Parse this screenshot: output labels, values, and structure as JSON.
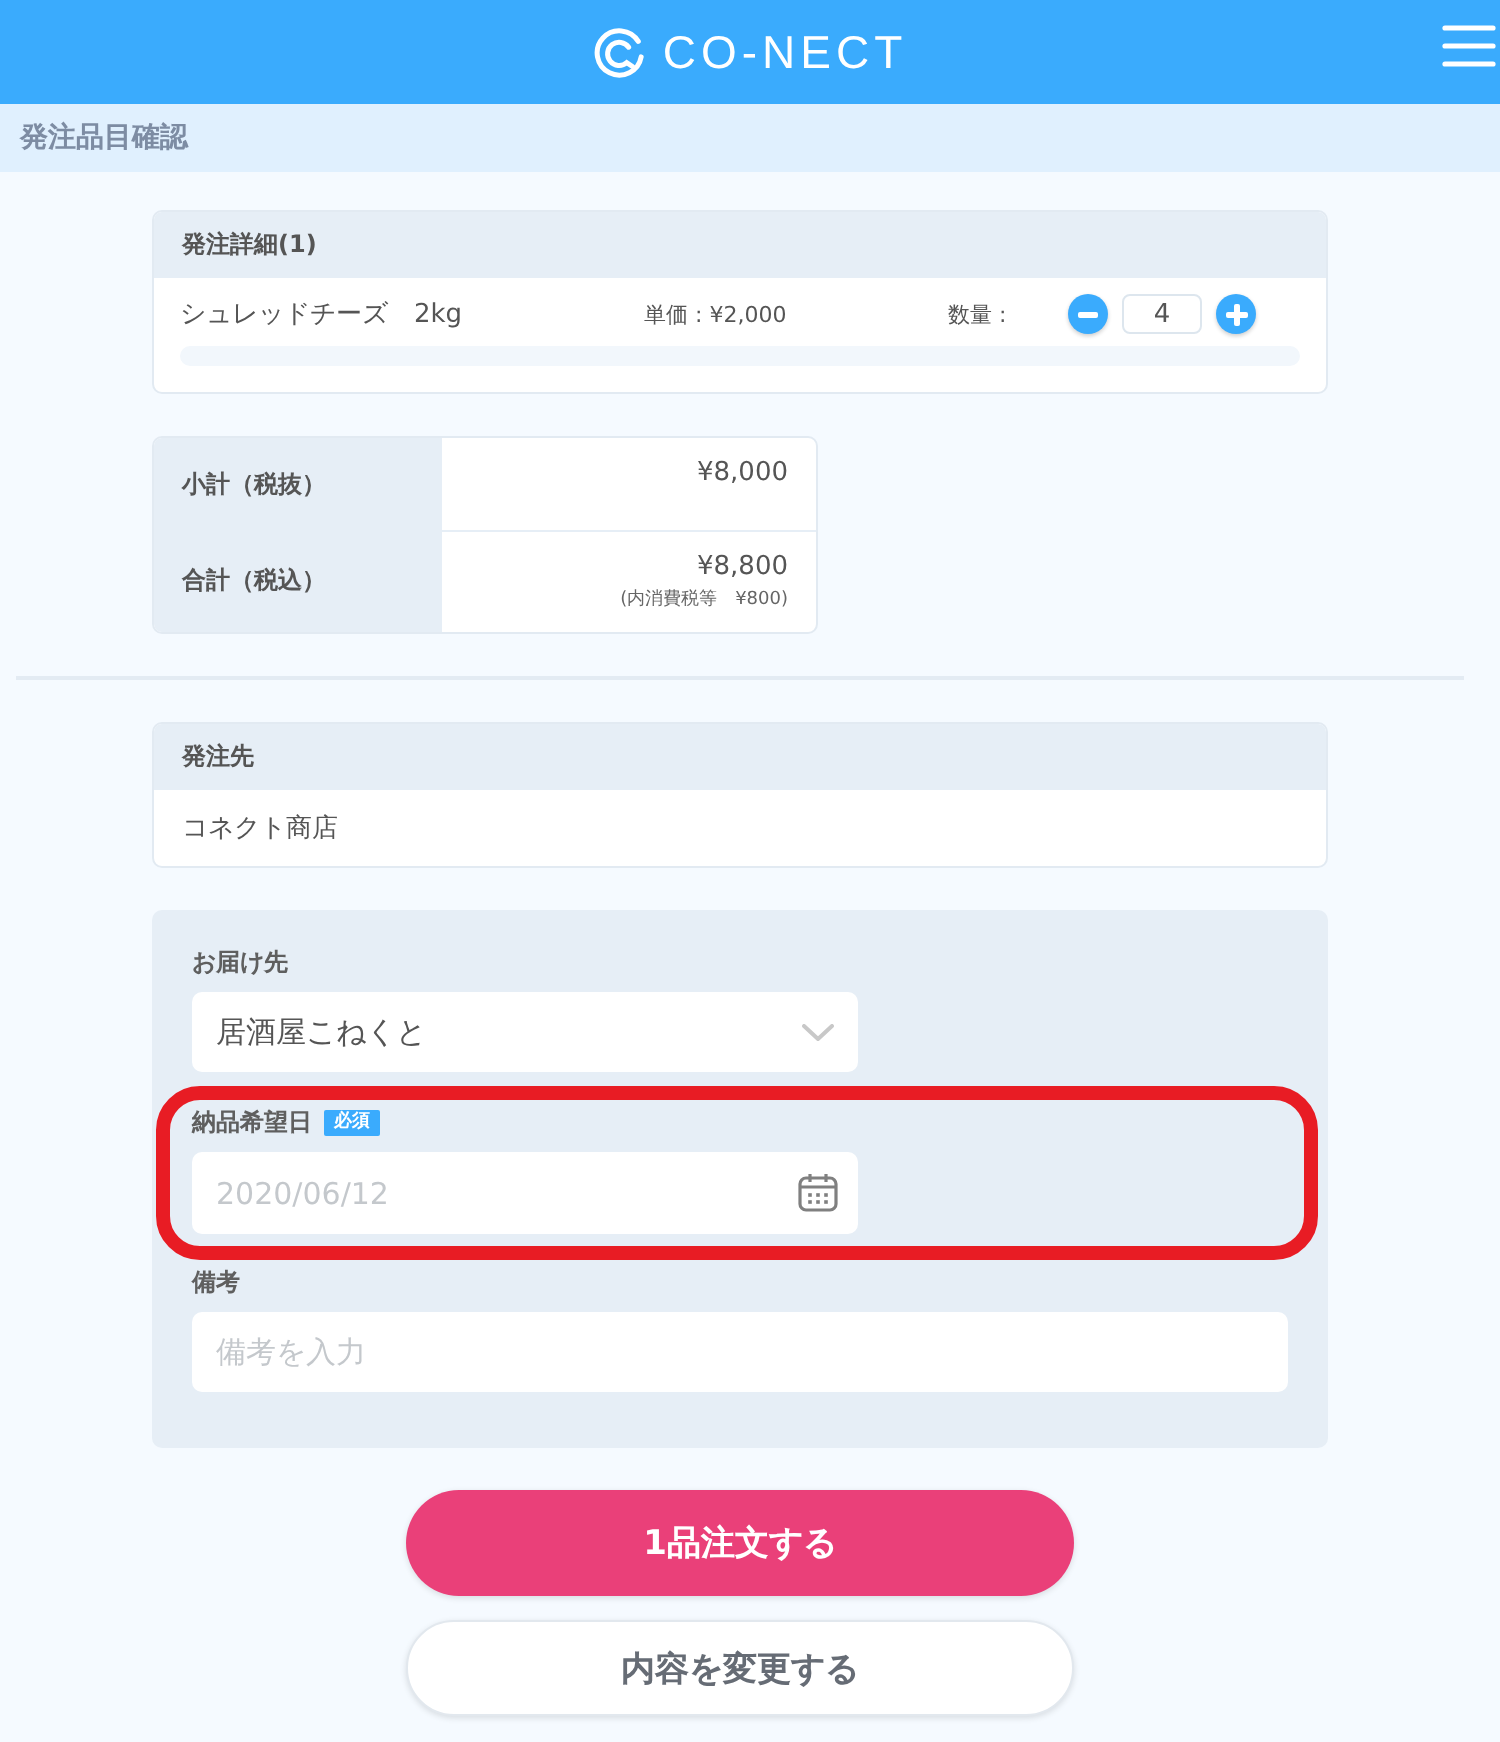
{
  "header": {
    "logo_text": "CO-NECT"
  },
  "page_title": "発注品目確認",
  "order_details": {
    "title": "発注詳細(1)",
    "items": [
      {
        "name": "シュレッドチーズ　2kg",
        "unit_price": "単価 : ¥2,000",
        "quantity_label": "数量 :",
        "quantity": "4"
      }
    ]
  },
  "totals": [
    {
      "label": "小計（税抜）",
      "value": "¥8,000"
    },
    {
      "label": "合計（税込）",
      "value": "¥8,800",
      "note": "(内消費税等　¥800)"
    }
  ],
  "supplier": {
    "title": "発注先",
    "name": "コネクト商店"
  },
  "form": {
    "delivery_to": {
      "label": "お届け先",
      "value": "居酒屋こねくと"
    },
    "delivery_date": {
      "label": "納品希望日",
      "badge": "必須",
      "placeholder": "2020/06/12",
      "highlighted": true
    },
    "remarks": {
      "label": "備考",
      "placeholder": "備考を入力"
    }
  },
  "buttons": [
    {
      "label": "1品注文する",
      "kind": "primary"
    },
    {
      "label": "内容を変更する",
      "kind": "secondary"
    }
  ]
}
